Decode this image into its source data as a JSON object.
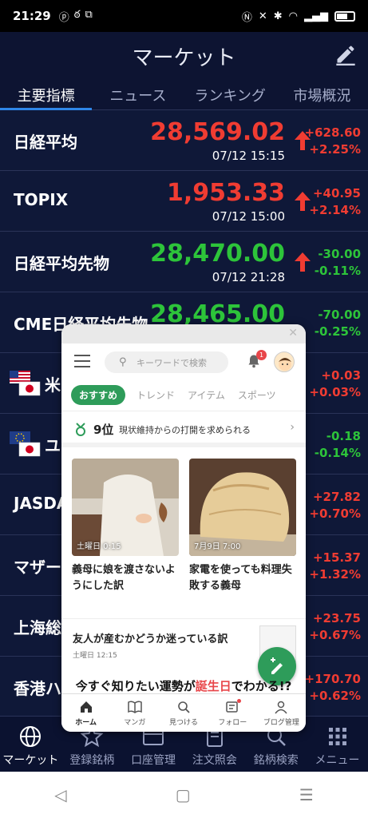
{
  "status_bar": {
    "time": "21:29",
    "left_icons": [
      "pinterest-icon",
      "cat-icon",
      "copy-icon"
    ],
    "right_icons": [
      "nfc-icon",
      "mute-icon",
      "bluetooth-icon",
      "wifi-icon",
      "volte-icon",
      "signal-icon",
      "battery-icon"
    ]
  },
  "header": {
    "title": "マーケット",
    "edit_icon": "pencil-icon"
  },
  "tabs": [
    "主要指標",
    "ニュース",
    "ランキング",
    "市場概況"
  ],
  "rows": [
    {
      "name": "日経平均",
      "price": "28,569.02",
      "time": "07/12 15:15",
      "change": "+628.60",
      "change_pct": "+2.25%",
      "direction": "up",
      "price_color": "red",
      "change_color": "red"
    },
    {
      "name": "TOPIX",
      "price": "1,953.33",
      "time": "07/12 15:00",
      "change": "+40.95",
      "change_pct": "+2.14%",
      "direction": "up",
      "price_color": "red",
      "change_color": "red"
    },
    {
      "name": "日経平均先物",
      "price": "28,470.00",
      "time": "07/12 21:28",
      "change": "-30.00",
      "change_pct": "-0.11%",
      "direction": "up",
      "price_color": "green",
      "change_color": "green"
    },
    {
      "name": "CME日経平均先物",
      "price": "28,465.00",
      "time": "",
      "change": "-70.00",
      "change_pct": "-0.25%",
      "direction": "",
      "price_color": "green",
      "change_color": "green"
    },
    {
      "name": "米",
      "price": "",
      "time": "",
      "change": "+0.03",
      "change_pct": "+0.03%",
      "direction": "",
      "price_color": "red",
      "change_color": "red",
      "flag": "us-jp"
    },
    {
      "name": "ユ",
      "price": "",
      "time": "",
      "change": "-0.18",
      "change_pct": "-0.14%",
      "direction": "",
      "price_color": "green",
      "change_color": "green",
      "flag": "eu-jp"
    },
    {
      "name": "JASDA",
      "price": "",
      "time": "",
      "change": "+27.82",
      "change_pct": "+0.70%",
      "direction": "",
      "price_color": "red",
      "change_color": "red"
    },
    {
      "name": "マザー",
      "price": "",
      "time": "",
      "change": "+15.37",
      "change_pct": "+1.32%",
      "direction": "",
      "price_color": "red",
      "change_color": "red"
    },
    {
      "name": "上海総",
      "price": "",
      "time": "",
      "change": "+23.75",
      "change_pct": "+0.67%",
      "direction": "",
      "price_color": "red",
      "change_color": "red"
    },
    {
      "name": "香港ハ",
      "price": "",
      "time": "",
      "change": "+170.70",
      "change_pct": "+0.62%",
      "direction": "",
      "price_color": "red",
      "change_color": "red"
    }
  ],
  "bottom_nav": [
    {
      "label": "マーケット",
      "icon": "globe-icon",
      "active": true
    },
    {
      "label": "登録銘柄",
      "icon": "star-icon",
      "active": false
    },
    {
      "label": "口座管理",
      "icon": "wallet-icon",
      "active": false
    },
    {
      "label": "注文照会",
      "icon": "document-icon",
      "active": false
    },
    {
      "label": "銘柄検索",
      "icon": "search-icon",
      "active": false
    },
    {
      "label": "メニュー",
      "icon": "grid-icon",
      "active": false
    }
  ],
  "overlay": {
    "search_placeholder": "キーワードで検索",
    "notification_count": "1",
    "categories": [
      "おすすめ",
      "トレンド",
      "アイテム",
      "スポーツ"
    ],
    "ranking": {
      "rank": "9位",
      "text": "現状維持からの打開を求められる"
    },
    "cards": [
      {
        "timestamp": "土曜日 0:15",
        "title": "義母に娘を渡さないようにした訳"
      },
      {
        "timestamp": "7月9日 7:00",
        "title": "家電を使っても料理失敗する義母"
      }
    ],
    "list_item": {
      "title": "友人が産むかどうか迷っている訳",
      "time": "土曜日 12:15"
    },
    "banner": {
      "before": "今すぐ知りたい運勢が",
      "highlight": "誕生日",
      "after": "でわかる!?"
    },
    "nav": [
      {
        "label": "ホーム",
        "icon": "home-icon"
      },
      {
        "label": "マンガ",
        "icon": "book-icon"
      },
      {
        "label": "見つける",
        "icon": "search-icon"
      },
      {
        "label": "フォロー",
        "icon": "follow-icon"
      },
      {
        "label": "ブログ管理",
        "icon": "person-icon"
      }
    ]
  },
  "colors": {
    "background": "#0d1432",
    "up": "#f03c32",
    "down": "#2dc43a",
    "accent": "#2e9c5a"
  }
}
